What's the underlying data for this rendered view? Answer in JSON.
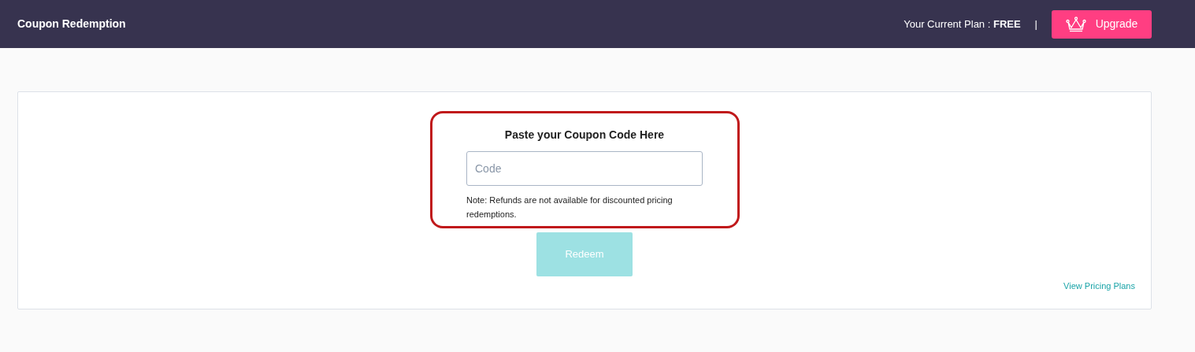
{
  "header": {
    "title": "Coupon Redemption",
    "plan_text": "Your Current Plan : **FREE**",
    "separator": "|",
    "upgrade_button": "Upgrade"
  },
  "coupon": {
    "heading": "Paste your Coupon Code Here",
    "highlighted": true,
    "code_field": {
      "placeholder": "Code"
    },
    "note": "Note: Refunds are not available for discounted pricing redemptions.",
    "redeem_button": {
      "label": "Redeem",
      "disabled": true
    }
  },
  "pricing_link": "View Pricing Plans"
}
